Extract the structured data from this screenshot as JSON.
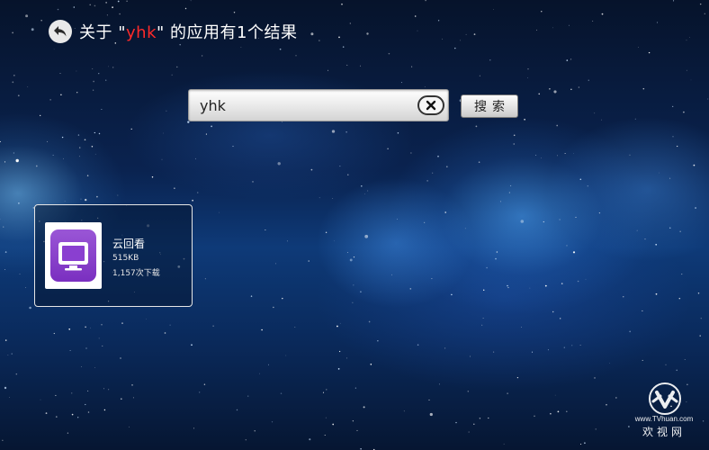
{
  "header": {
    "title_prefix": "关于 \"",
    "keyword": "yhk",
    "title_suffix": "\" 的应用有1个结果",
    "back_icon": "back-arrow-icon"
  },
  "search": {
    "value": "yhk",
    "clear_icon": "close-icon",
    "button_label": "搜索"
  },
  "results": [
    {
      "name": "云回看",
      "size": "515KB",
      "downloads": "1,157次下载",
      "icon": "tv-monitor-icon",
      "icon_color": "#8a3fd0"
    }
  ],
  "watermark": {
    "url": "www.TVhuan.com",
    "brand": "欢视网"
  },
  "colors": {
    "keyword_highlight": "#ff2a2a",
    "background": "#0a2350"
  }
}
